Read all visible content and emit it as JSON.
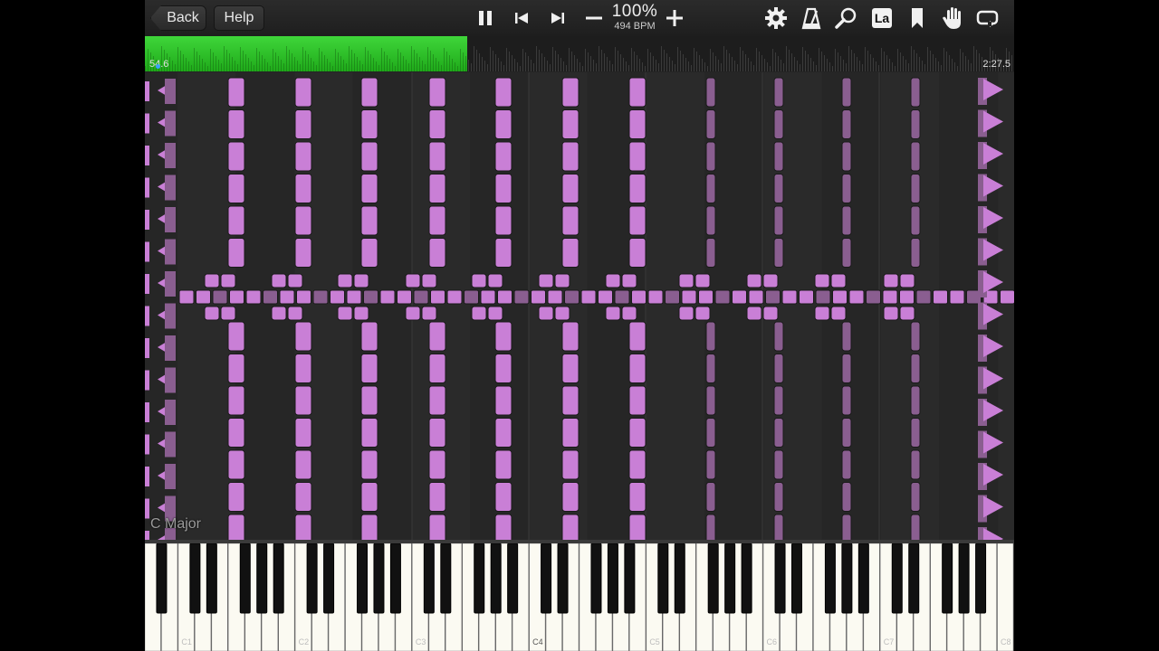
{
  "toolbar": {
    "back_label": "Back",
    "help_label": "Help",
    "tempo_percent": "100%",
    "tempo_bpm": "494 BPM",
    "label_mode": "La",
    "icons": [
      "pause-icon",
      "skip-back-icon",
      "skip-forward-icon",
      "minus-icon",
      "plus-icon",
      "gear-icon",
      "metronome-icon",
      "zoom-icon",
      "note-label-icon",
      "bookmark-icon",
      "hand-icon",
      "loop-icon"
    ]
  },
  "progress": {
    "current_time": "54.6",
    "total_time": "2:27.5",
    "fraction": 0.371,
    "fill_color": "#2ec12a"
  },
  "roll": {
    "key_signature": "C Major",
    "note_color": "#c97fd6",
    "dim_note_color": "#8a5e90"
  },
  "keyboard": {
    "octave_labels": [
      "C1",
      "C2",
      "C3",
      "C4",
      "C5",
      "C6",
      "C7",
      "C8"
    ]
  }
}
